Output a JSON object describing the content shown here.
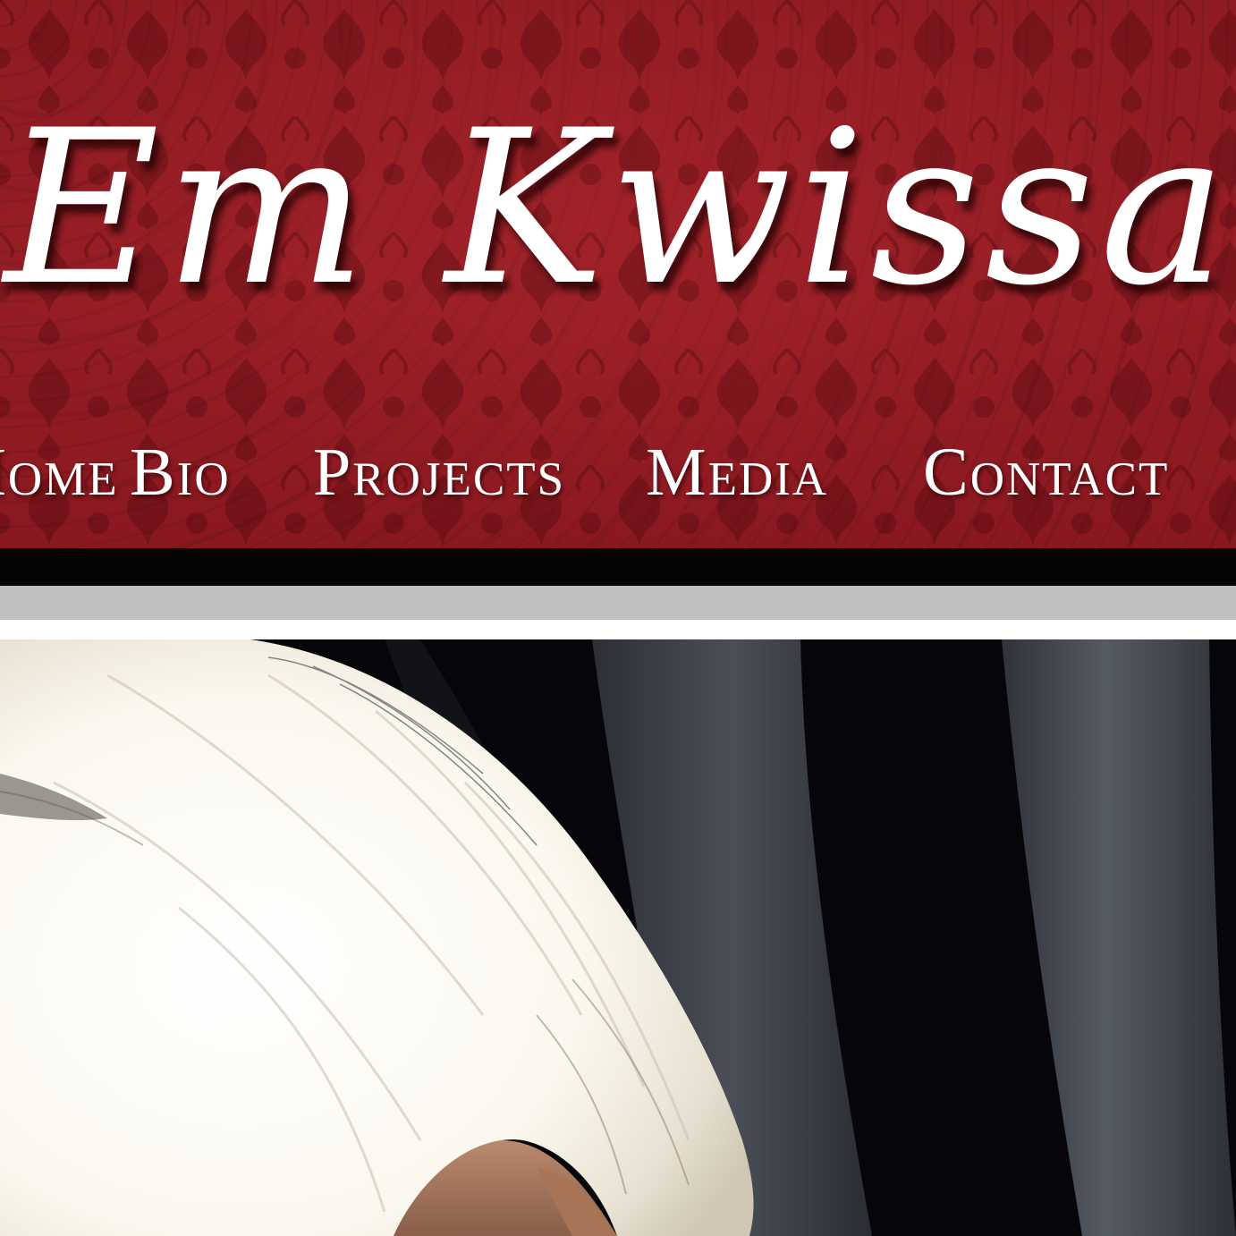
{
  "site": {
    "title": "Em Kwissa",
    "brand_color": "#931c24"
  },
  "nav": {
    "items": [
      {
        "label": "Home"
      },
      {
        "label": "Bio"
      },
      {
        "label": "Projects"
      },
      {
        "label": "Media"
      },
      {
        "label": "Contact"
      }
    ]
  },
  "hero": {
    "image": "portrait-photo"
  }
}
